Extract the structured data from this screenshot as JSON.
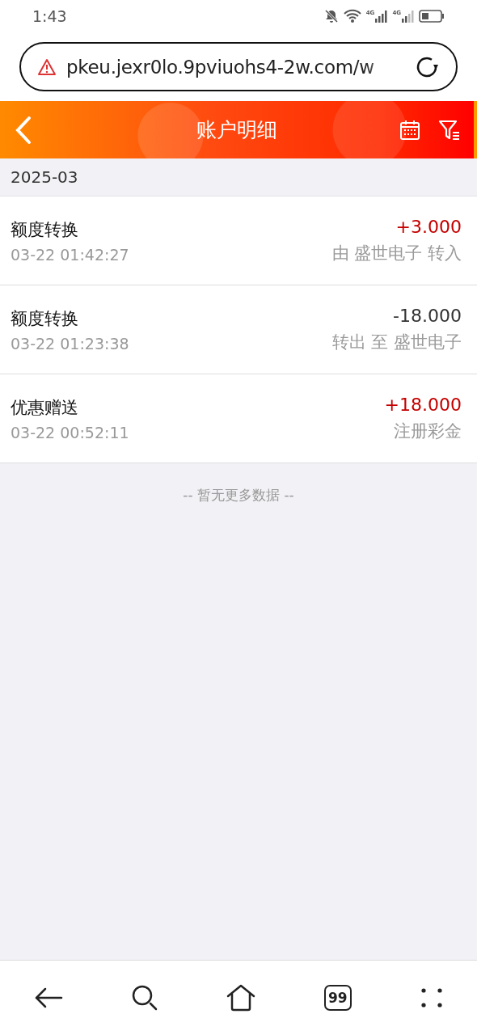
{
  "status_bar": {
    "time": "1:43",
    "network_1": "4G",
    "network_2": "4G"
  },
  "browser": {
    "url": "pkeu.jexr0lo.9pviuohs4-2w.com/w"
  },
  "header": {
    "title": "账户明细"
  },
  "month": "2025-03",
  "transactions": [
    {
      "type": "额度转换",
      "time": "03-22 01:42:27",
      "amount": "+3.000",
      "description": "由 盛世电子 转入",
      "kind": "credit"
    },
    {
      "type": "额度转换",
      "time": "03-22 01:23:38",
      "amount": "-18.000",
      "description": "转出 至 盛世电子",
      "kind": "debit"
    },
    {
      "type": "优惠赠送",
      "time": "03-22 00:52:11",
      "amount": "+18.000",
      "description": "注册彩金",
      "kind": "credit"
    }
  ],
  "end_note": "-- 暂无更多数据 --",
  "bottom_nav": {
    "tab_count": "99"
  }
}
